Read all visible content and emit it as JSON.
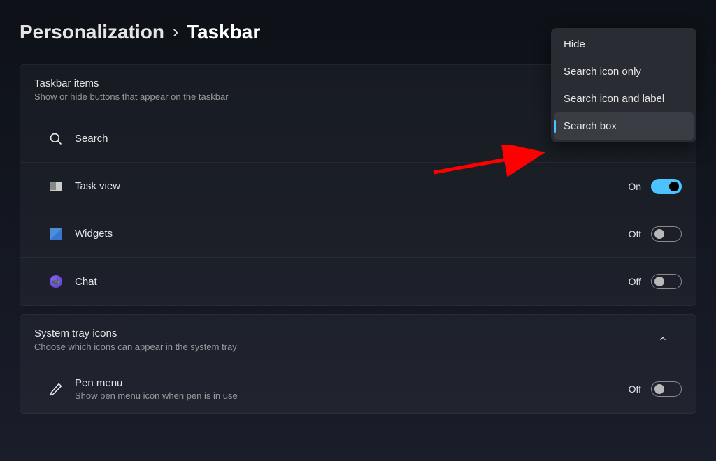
{
  "breadcrumb": {
    "parent": "Personalization",
    "separator": "›",
    "current": "Taskbar"
  },
  "sections": {
    "taskbar_items": {
      "title": "Taskbar items",
      "subtitle": "Show or hide buttons that appear on the taskbar",
      "rows": {
        "search": {
          "label": "Search"
        },
        "taskview": {
          "label": "Task view",
          "state": "On"
        },
        "widgets": {
          "label": "Widgets",
          "state": "Off"
        },
        "chat": {
          "label": "Chat",
          "state": "Off"
        }
      }
    },
    "system_tray": {
      "title": "System tray icons",
      "subtitle": "Choose which icons can appear in the system tray",
      "rows": {
        "pen_menu": {
          "label": "Pen menu",
          "sub": "Show pen menu icon when pen is in use",
          "state": "Off"
        }
      }
    }
  },
  "dropdown": {
    "options": [
      {
        "label": "Hide"
      },
      {
        "label": "Search icon only"
      },
      {
        "label": "Search icon and label"
      },
      {
        "label": "Search box",
        "selected": true
      }
    ]
  }
}
